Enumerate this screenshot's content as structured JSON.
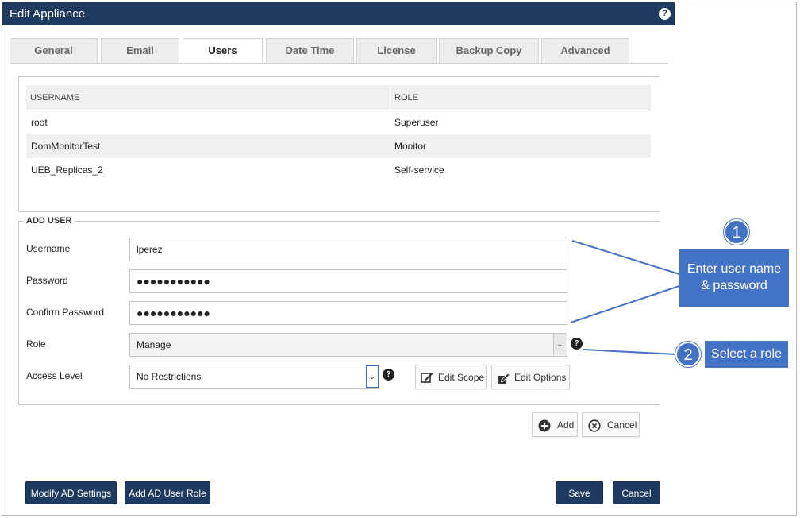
{
  "window": {
    "title": "Edit Appliance",
    "help_icon": "help-icon"
  },
  "tabs": [
    {
      "label": "General"
    },
    {
      "label": "Email"
    },
    {
      "label": "Users",
      "active": true
    },
    {
      "label": "Date Time"
    },
    {
      "label": "License"
    },
    {
      "label": "Backup Copy"
    },
    {
      "label": "Advanced"
    }
  ],
  "users_table": {
    "columns": [
      "USERNAME",
      "ROLE"
    ],
    "rows": [
      {
        "username": "root",
        "role": "Superuser"
      },
      {
        "username": "DomMonitorTest",
        "role": "Monitor"
      },
      {
        "username": "UEB_Replicas_2",
        "role": "Self-service"
      }
    ]
  },
  "add_user": {
    "legend": "ADD USER",
    "username": {
      "label": "Username",
      "value": "lperez"
    },
    "password": {
      "label": "Password",
      "value": "●●●●●●●●●●●"
    },
    "confirm_password": {
      "label": "Confirm Password",
      "value": "●●●●●●●●●●●"
    },
    "role": {
      "label": "Role",
      "selected": "Manage"
    },
    "access_level": {
      "label": "Access Level",
      "selected": "No Restrictions"
    },
    "edit_scope_label": "Edit Scope",
    "edit_options_label": "Edit Options",
    "add_label": "Add",
    "cancel_label": "Cancel"
  },
  "footer": {
    "modify_ad_label": "Modify AD Settings",
    "add_ad_role_label": "Add AD User Role",
    "save_label": "Save",
    "cancel_label": "Cancel"
  },
  "annotations": [
    {
      "number": "1",
      "text_line1": "Enter user name",
      "text_line2": "& password"
    },
    {
      "number": "2",
      "text": "Select a role"
    }
  ],
  "colors": {
    "title_bar": "#1f3a5f",
    "callout": "#4472c4",
    "primary_button": "#1f3a5f"
  }
}
